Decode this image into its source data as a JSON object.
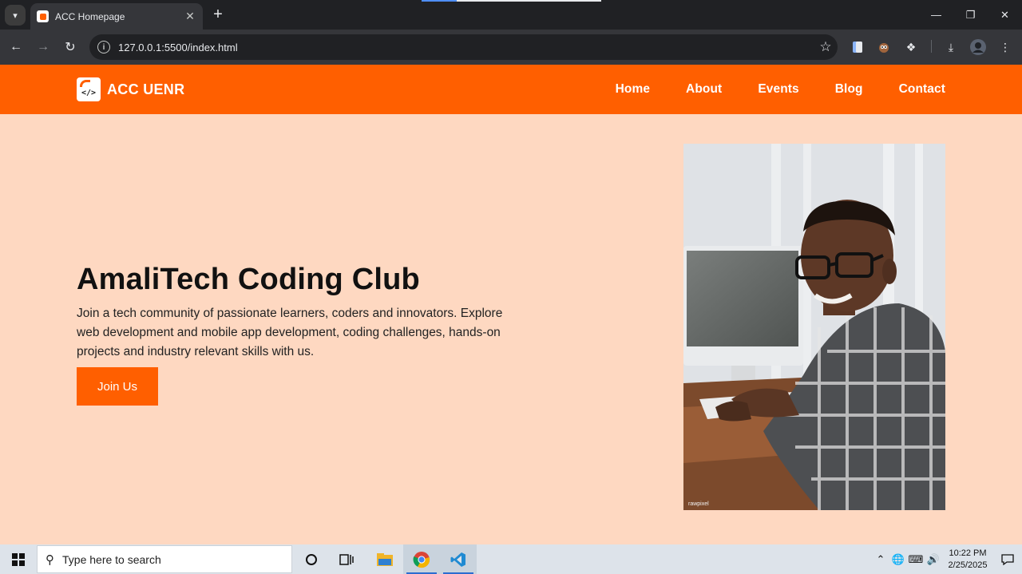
{
  "browser": {
    "tab_title": "ACC Homepage",
    "new_tab": "+",
    "url": "127.0.0.1:5500/index.html",
    "icons": [
      "tab-search-icon",
      "close-icon",
      "back-icon",
      "forward-icon",
      "reload-icon",
      "info-icon",
      "star-icon",
      "extension-icon",
      "download-icon",
      "profile-icon",
      "menu-icon"
    ]
  },
  "site": {
    "logo_text": "ACC UENR",
    "logo_glyph": "</>",
    "nav": [
      "Home",
      "About",
      "Events",
      "Blog",
      "Contact"
    ],
    "hero": {
      "title": "AmaliTech Coding Club",
      "text": "Join a tech community of passionate learners, coders and innovators. Explore web development and mobile app development, coding challenges, hands-on projects and industry relevant skills with us.",
      "cta": "Join Us",
      "photo_watermark": "rawpixel"
    },
    "colors": {
      "brand": "#ff5f00",
      "background": "#fed8c1"
    }
  },
  "taskbar": {
    "search_placeholder": "Type here to search",
    "time": "10:22 PM",
    "date": "2/25/2025",
    "apps": [
      "task-view-icon",
      "file-explorer-icon",
      "chrome-icon",
      "vscode-icon"
    ]
  }
}
